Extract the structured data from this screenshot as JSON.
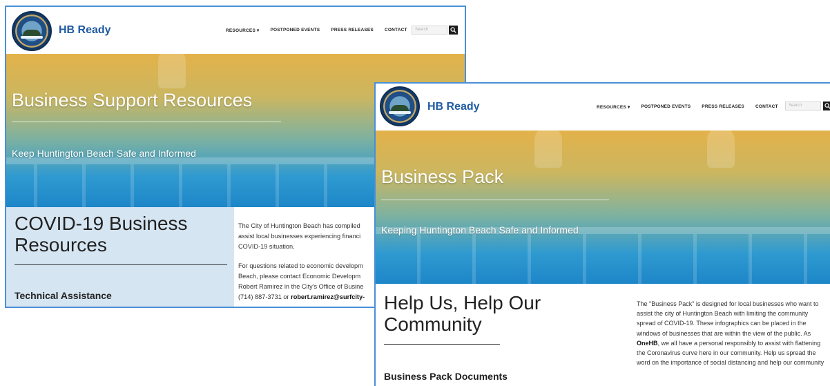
{
  "shot_a": {
    "brand": "HB Ready",
    "nav": {
      "resources": "RESOURCES ▾",
      "postponed": "POSTPONED EVENTS",
      "press": "PRESS RELEASES",
      "contact": "CONTACT"
    },
    "search_placeholder": "Search",
    "hero": {
      "title": "Business Support Resources",
      "subtitle": "Keep Huntington Beach Safe and Informed"
    },
    "content": {
      "title": "COVID-19 Business Resources",
      "section": "Technical Assistance",
      "para1": "The City of Huntington Beach has compiled assist local businesses experiencing financi COVID-19 situation.",
      "para2_text": "For questions related to economic developm Beach, please contact Economic Developm Robert Ramirez in the City's Office of Busine (714) 887-3731 or",
      "para2_email": "robert.ramirez@surfcity-"
    }
  },
  "shot_b": {
    "brand": "HB Ready",
    "nav": {
      "resources": "RESOURCES ▾",
      "postponed": "POSTPONED EVENTS",
      "press": "PRESS RELEASES",
      "contact": "CONTACT"
    },
    "search_placeholder": "Search",
    "hero": {
      "title": "Business Pack",
      "subtitle": "Keeping Huntington Beach Safe and Informed"
    },
    "content": {
      "title": "Help Us, Help Our Community",
      "section": "Business Pack Documents",
      "para_a": "The \"Business Pack\" is designed for local businesses who want to assist the city of Huntington Beach with limiting the community spread of COVID-19. These infographics can be placed in the windows of businesses that are within the view of the public. As",
      "para_strong": "OneHB",
      "para_b": ", we all have a personal responsibly to assist with flattening the Coronavirus curve here in our community. Help us spread the word on the importance of social distancing and help our community"
    }
  }
}
